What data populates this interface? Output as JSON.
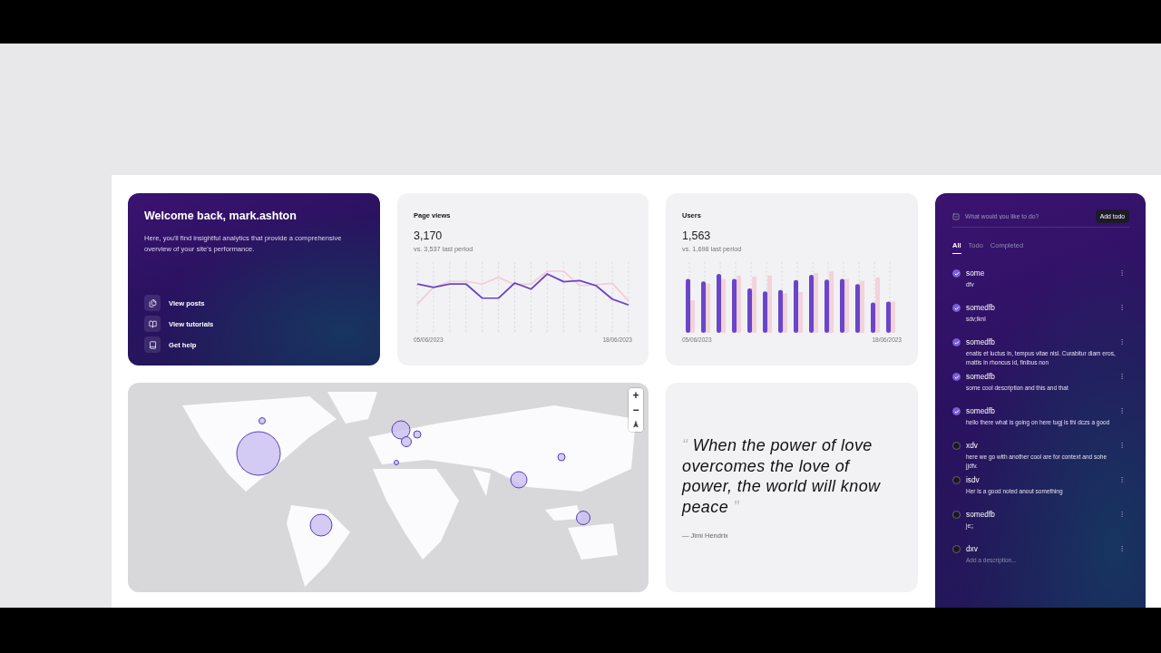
{
  "welcome": {
    "title": "Welcome back, mark.ashton",
    "text": "Here, you'll find insightful analytics that provide a comprehensive overview of your site's performance.",
    "links": [
      {
        "label": "View posts"
      },
      {
        "label": "View tutorials"
      },
      {
        "label": "Get help"
      }
    ]
  },
  "stats": [
    {
      "kind": "line",
      "title": "Page views",
      "value": "3,170",
      "comparison": "vs. 3,537 last period",
      "start_date": "05/06/2023",
      "end_date": "18/06/2023"
    },
    {
      "kind": "bar",
      "title": "Users",
      "value": "1,563",
      "comparison": "vs. 1,698 last period",
      "start_date": "05/06/2023",
      "end_date": "18/06/2023"
    }
  ],
  "map": {
    "kind": "picture",
    "zoom_in": "+",
    "zoom_out": "−"
  },
  "quote": {
    "open_mark": "“",
    "text": "When the power of love overcomes the love of power, the world will know peace",
    "close_mark": "”",
    "author": "— Jimi Hendrix"
  },
  "todo": {
    "placeholder": "What would you like to do?",
    "add_button": "Add todo",
    "tabs": [
      {
        "label": "All",
        "selected": true
      },
      {
        "label": "Todo",
        "selected": false
      },
      {
        "label": "Completed",
        "selected": false
      }
    ],
    "items": [
      {
        "title": "some",
        "description": "dfv",
        "checked": true
      },
      {
        "title": "somedfb",
        "description": "sdv;lknl",
        "checked": true
      },
      {
        "title": "somedfb",
        "description": "enatis et luctus in, tempus vitae nisl. Curabitur diam eros, mattis in rhoncus id, finibus non",
        "checked": true
      },
      {
        "title": "somedfb",
        "description": "some cool description and this and that",
        "checked": true
      },
      {
        "title": "somedfb",
        "description": "hello there what is going on here tugj is thi dczs a good",
        "checked": true
      },
      {
        "title": "xdv",
        "description": "here we go with another cool are for context and sohe jjdfv.",
        "checked": false
      },
      {
        "title": "isdv",
        "description": "Her is a good noted anout something",
        "checked": false
      },
      {
        "title": "somedfb",
        "description": "je;;",
        "checked": false
      },
      {
        "title": "dxv",
        "placeholder": "Add a description...",
        "checked": false
      }
    ]
  }
}
